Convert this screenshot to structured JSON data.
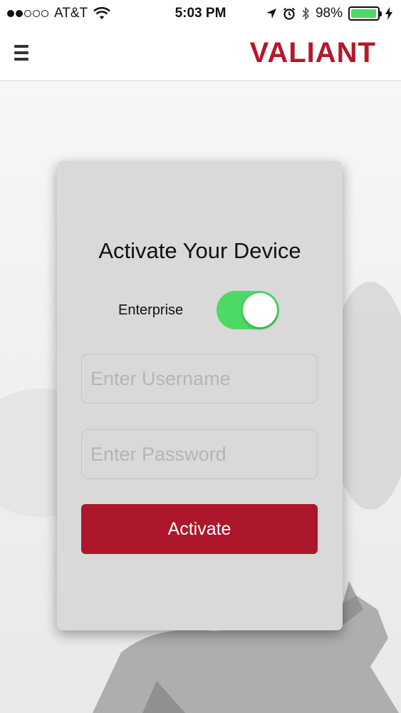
{
  "status_bar": {
    "carrier": "AT&T",
    "time": "5:03 PM",
    "battery_percent": "98%",
    "battery_level": 0.98,
    "signal_bars": 2,
    "signal_total": 5,
    "icons": [
      "wifi-icon",
      "location-arrow-icon",
      "alarm-icon",
      "bluetooth-icon",
      "battery-icon",
      "charging-bolt-icon"
    ]
  },
  "header": {
    "menu_icon": "hamburger-menu-icon",
    "brand": "VALIANT"
  },
  "form": {
    "title": "Activate Your Device",
    "toggle_label": "Enterprise",
    "toggle_on": true,
    "username_placeholder": "Enter Username",
    "username_value": "",
    "password_placeholder": "Enter Password",
    "password_value": "",
    "activate_label": "Activate"
  },
  "colors": {
    "brand_red": "#b5172c",
    "button_red": "#ad172b",
    "toggle_green": "#4cd964",
    "battery_green": "#4cd964",
    "card_bg": "#d9d9d9"
  }
}
